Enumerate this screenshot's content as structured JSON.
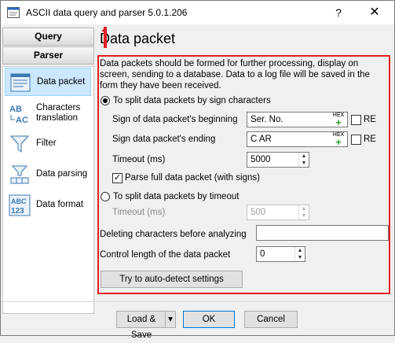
{
  "window": {
    "title": "ASCII data query and parser 5.0.1.206",
    "help": "?",
    "close": "✕"
  },
  "nav": {
    "query_label": "Query",
    "parser_label": "Parser",
    "items": [
      {
        "label": "Data packet",
        "icon": "data-packet-icon"
      },
      {
        "label": "Characters translation",
        "icon": "characters-translation-icon"
      },
      {
        "label": "Filter",
        "icon": "filter-icon"
      },
      {
        "label": "Data parsing",
        "icon": "data-parsing-icon"
      },
      {
        "label": "Data format",
        "icon": "data-format-icon"
      }
    ]
  },
  "page": {
    "title": "Data packet",
    "description": "Data packets should be formed for further processing, display on screen, sending to a database. Data to a log file will be saved in the form they have been received.",
    "split_by_sign": {
      "label": "To split data packets by sign characters",
      "begin_label": "Sign of data packet's beginning",
      "begin_value": "Ser. No.",
      "end_label": "Sign data packet's ending",
      "end_value": "C AR",
      "re_label": "RE",
      "timeout_label": "Timeout (ms)",
      "timeout_value": "5000",
      "parse_full_label": "Parse full data packet (with signs)"
    },
    "split_by_timeout": {
      "label": "To split data packets by timeout",
      "timeout_label": "Timeout (ms)",
      "timeout_value": "500"
    },
    "delete_chars_label": "Deleting characters before analyzing",
    "delete_chars_value": "",
    "control_length_label": "Control length of the data packet",
    "control_length_value": "0",
    "autodetect_label": "Try to auto-detect settings",
    "hex_label": "HEX"
  },
  "footer": {
    "load_save": "Load & Save",
    "ok": "OK",
    "cancel": "Cancel",
    "dropdown": "▾"
  },
  "colors": {
    "highlight": "#e51e25",
    "selected": "#cce8ff"
  }
}
